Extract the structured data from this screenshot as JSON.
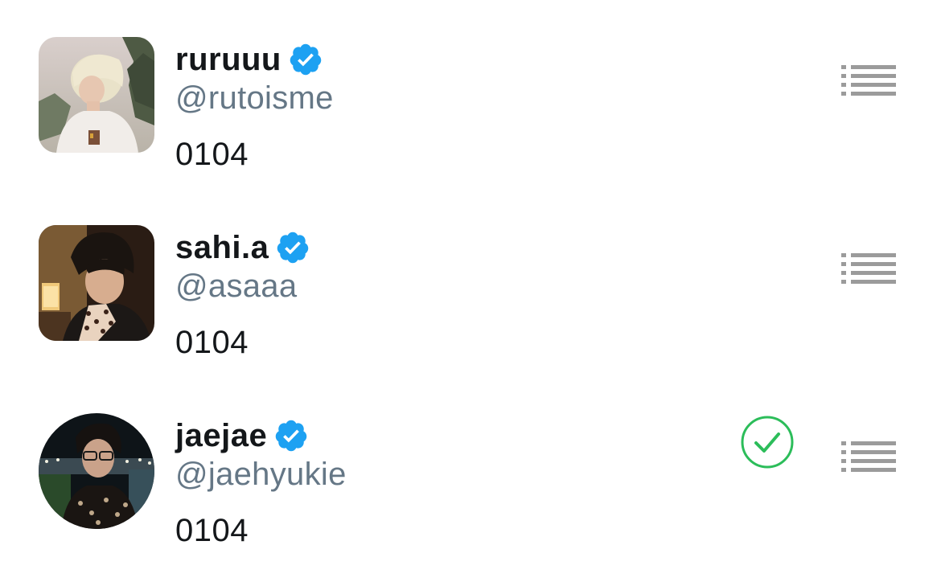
{
  "users": [
    {
      "display_name": "ruruuu",
      "handle": "@rutoisme",
      "bio": "0104",
      "verified": true,
      "avatar_icon": "profile-photo",
      "action_icon": "list-icon",
      "added_to_list": false
    },
    {
      "display_name": "sahi.a",
      "handle": "@asaaa",
      "bio": "0104",
      "verified": true,
      "avatar_icon": "profile-photo",
      "action_icon": "list-icon",
      "added_to_list": false
    },
    {
      "display_name": "jaejae",
      "handle": "@jaehyukie",
      "bio": "0104",
      "verified": true,
      "avatar_icon": "profile-photo",
      "action_icon": "list-icon",
      "added_to_list": true
    }
  ],
  "colors": {
    "verified_blue": "#1da1f2",
    "handle_gray": "#657786",
    "text_dark": "#14171a",
    "menu_gray": "#9b9b9b",
    "check_green": "#2cbd5a"
  }
}
